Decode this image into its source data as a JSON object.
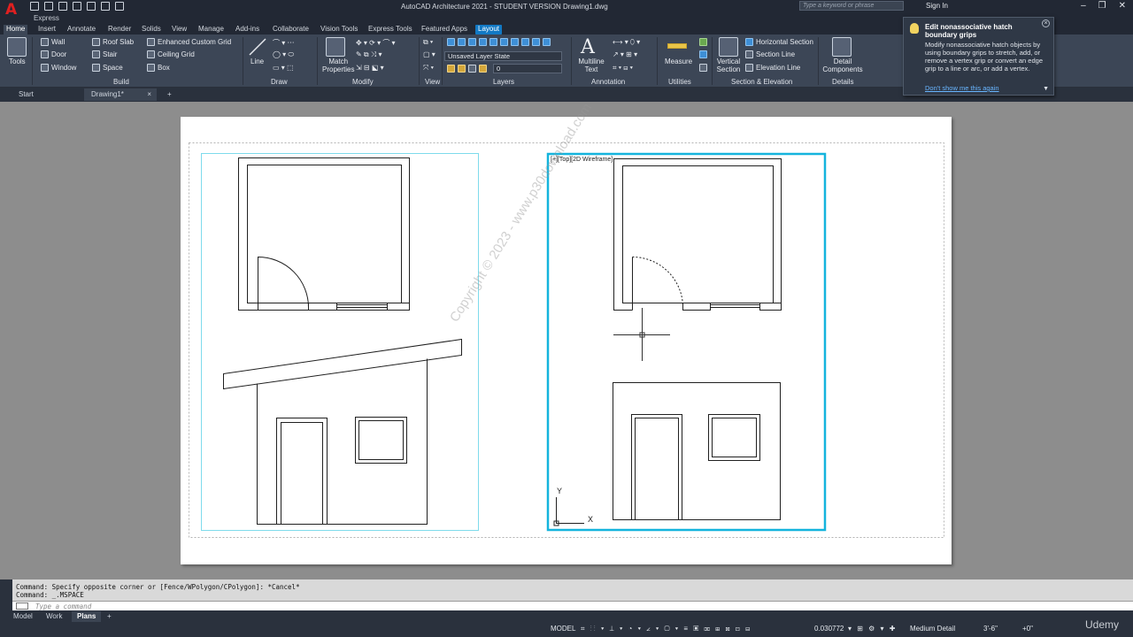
{
  "app": {
    "title": "AutoCAD Architecture 2021 - STUDENT VERSION    Drawing1.dwg",
    "workspace": "Express",
    "search_placeholder": "Type a keyword or phrase",
    "sign_in": "Sign In"
  },
  "ribbon_tabs": [
    "Home",
    "Insert",
    "Annotate",
    "Render",
    "Solids",
    "View",
    "Manage",
    "Add-ins",
    "Collaborate",
    "Vision Tools",
    "Express Tools",
    "Featured Apps",
    "Layout"
  ],
  "ribbon": {
    "tools": "Tools",
    "build": {
      "label": "Build",
      "wall": "Wall",
      "door": "Door",
      "window": "Window",
      "roof_slab": "Roof Slab",
      "stair": "Stair",
      "space": "Space",
      "enhanced_grid": "Enhanced Custom Grid",
      "ceiling_grid": "Ceiling Grid",
      "box": "Box"
    },
    "draw": {
      "label": "Draw",
      "line": "Line"
    },
    "modify": {
      "label": "Modify",
      "match_properties": "Match Properties"
    },
    "view": {
      "label": "View"
    },
    "layers": {
      "label": "Layers",
      "layer_state": "Unsaved Layer State",
      "layer": "0"
    },
    "annotation": {
      "label": "Annotation",
      "multiline_text": "Multiline Text"
    },
    "utilities": {
      "label": "Utilities",
      "measure": "Measure"
    },
    "section": {
      "label": "Section & Elevation",
      "vertical": "Vertical Section",
      "horizontal": "Horizontal Section",
      "section_line": "Section Line",
      "elevation_line": "Elevation Line"
    },
    "details": {
      "label": "Details",
      "detail_components": "Detail Components"
    }
  },
  "doc_tabs": {
    "start": "Start",
    "drawing": "Drawing1*"
  },
  "viewport": {
    "label": "[+][Top][2D Wireframe]",
    "ucs_x": "X",
    "ucs_y": "Y"
  },
  "watermark": "Copyright © 2023 - www.p30download.com",
  "tooltip": {
    "title": "Edit nonassociative hatch boundary grips",
    "body": "Modify nonassociative hatch objects by using boundary grips to stretch, add, or remove a vertex grip or convert an edge grip to a line or arc, or add a vertex.",
    "link": "Don't show me this again"
  },
  "command": {
    "line1": "Command: Specify opposite corner or [Fence/WPolygon/CPolygon]: *Cancel*",
    "line2": "Command:  _.MSPACE",
    "placeholder": "Type a command"
  },
  "layout_tabs": [
    "Model",
    "Work",
    "Plans"
  ],
  "status": {
    "model": "MODEL",
    "scale": "0.030772",
    "detail": "Medium Detail",
    "dim": "3'-6\"",
    "plus": "+0\"",
    "udemy": "Udemy"
  }
}
